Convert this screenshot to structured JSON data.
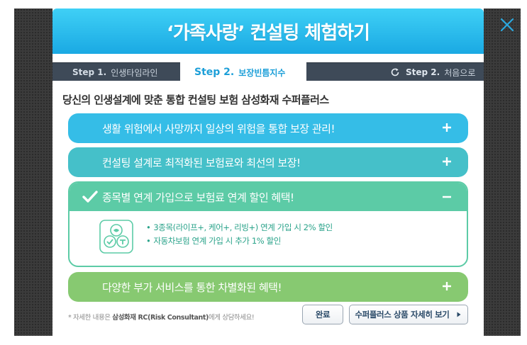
{
  "dialog": {
    "title": "‘가족사랑’ 컨설팅 체험하기",
    "close_icon": "close-icon"
  },
  "tabs": [
    {
      "step": "Step 1.",
      "name": "인생타임라인",
      "active": false
    },
    {
      "step": "Step 2.",
      "name": "보장빈틈지수",
      "active": true
    }
  ],
  "restart": {
    "icon": "refresh-icon",
    "step": "Step 2.",
    "label": "처음으로"
  },
  "headline": "당신의 인생설계에 맞춘 통합 컨설팅 보험 삼성화재 수퍼플러스",
  "accordion": [
    {
      "label": "생활 위험에서 사망까지 일상의 위험을 통합 보장 관리!",
      "toggle": "+",
      "expanded": false,
      "color": "#35bde7"
    },
    {
      "label": "컨설팅 설계로 최적화된 보험료와 최선의 보장!",
      "toggle": "+",
      "expanded": false,
      "color": "#45c0c9"
    },
    {
      "label": "종목별 연계 가입으로 보험료 연계 할인 혜택!",
      "toggle": "−",
      "expanded": true,
      "color": "#5ccba6",
      "details": [
        "3종목(라이프+, 케어+, 리빙+) 연계 가입 시 2% 할인",
        "자동차보험  연계 가입 시 추가 1% 할인"
      ]
    },
    {
      "label": "다양한 부가 서비스를 통한 차별화된 혜택!",
      "toggle": "+",
      "expanded": false,
      "color": "#87c971"
    }
  ],
  "footnote": {
    "prefix": "* 자세한 내용은 ",
    "bold": "삼성화재 RC(Risk Consultant)",
    "suffix": "에게 상담하세요!"
  },
  "buttons": {
    "done": "완료",
    "detail": "수퍼플러스 상품 자세히 보기"
  }
}
